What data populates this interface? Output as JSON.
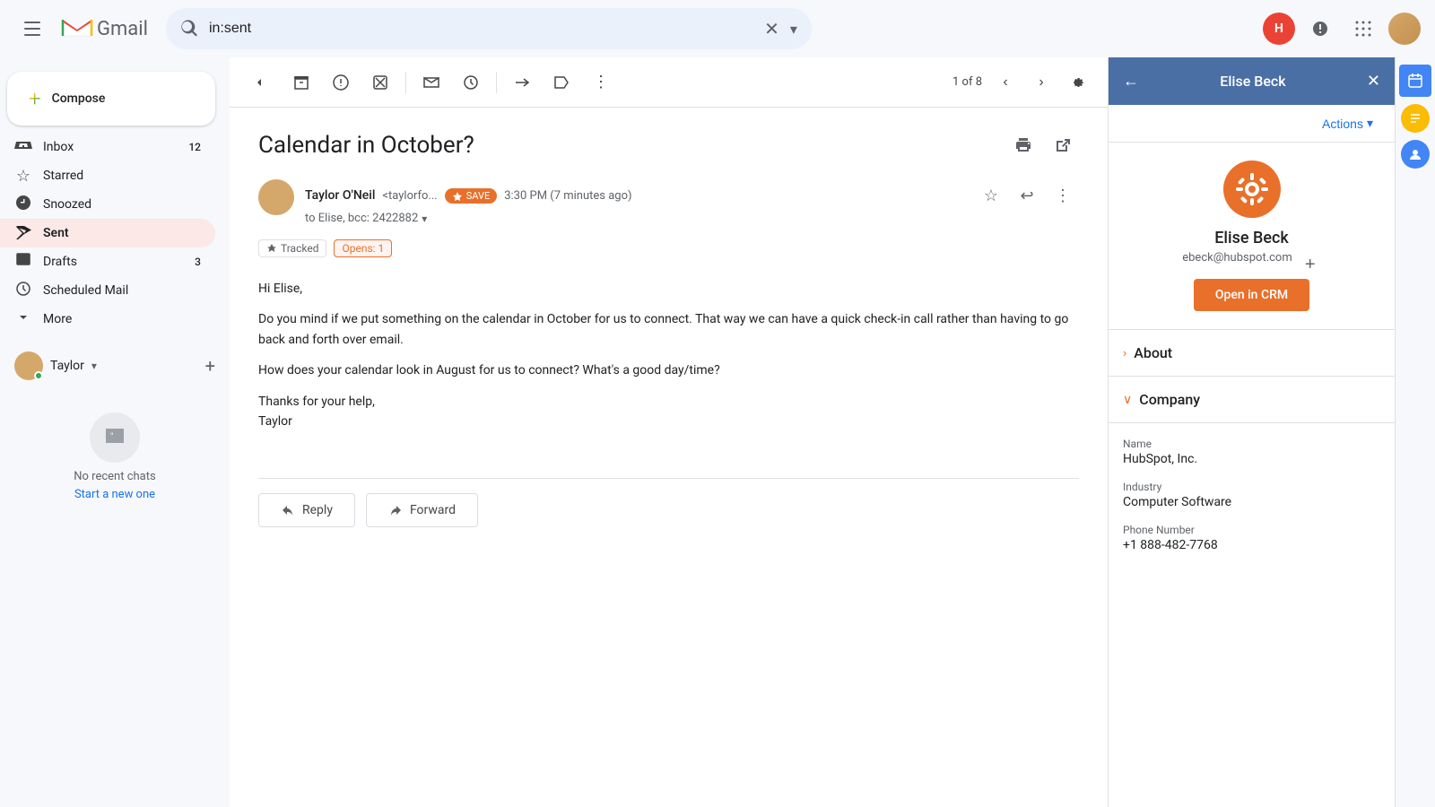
{
  "topbar": {
    "search_placeholder": "in:sent",
    "search_value": "in:sent",
    "gmail_label": "Gmail"
  },
  "sidebar": {
    "compose_label": "Compose",
    "nav_items": [
      {
        "id": "inbox",
        "label": "Inbox",
        "icon": "☰",
        "badge": "12",
        "active": false
      },
      {
        "id": "starred",
        "label": "Starred",
        "icon": "★",
        "badge": "",
        "active": false
      },
      {
        "id": "snoozed",
        "label": "Snoozed",
        "icon": "🕐",
        "badge": "",
        "active": false
      },
      {
        "id": "sent",
        "label": "Sent",
        "icon": "➤",
        "badge": "",
        "active": true
      },
      {
        "id": "drafts",
        "label": "Drafts",
        "icon": "📄",
        "badge": "3",
        "active": false
      },
      {
        "id": "scheduled",
        "label": "Scheduled Mail",
        "icon": "🕐",
        "badge": "",
        "active": false
      },
      {
        "id": "more",
        "label": "More",
        "icon": "∨",
        "badge": "",
        "active": false
      }
    ],
    "user_name": "Taylor",
    "no_chats_text": "No recent chats",
    "start_new_link": "Start a new one"
  },
  "toolbar": {
    "back_label": "←",
    "pagination_text": "1 of 8"
  },
  "email": {
    "subject": "Calendar in October?",
    "sender_name": "Taylor O'Neil",
    "sender_email": "<taylorfo...",
    "save_label": "SAVE",
    "time": "3:30 PM (7 minutes ago)",
    "to": "to Elise, bcc: 2422882",
    "tracked_label": "Tracked",
    "opens_label": "Opens: 1",
    "body_lines": [
      "Hi Elise,",
      "",
      "Do you mind if we put something on the calendar in October for us to connect. That way we can have a quick check-in call rather than having to go back and forth over email.",
      "",
      "How does your calendar look in August for us to connect? What's a good day/time?",
      "",
      "Thanks for your help,",
      "Taylor"
    ],
    "reply_label": "Reply",
    "forward_label": "Forward"
  },
  "right_panel": {
    "contact_name": "Elise Beck",
    "contact_email": "ebeck@hubspot.com",
    "actions_label": "Actions",
    "open_crm_label": "Open in CRM",
    "about_label": "About",
    "company_label": "Company",
    "company_name_label": "Name",
    "company_name_value": "HubSpot, Inc.",
    "industry_label": "Industry",
    "industry_value": "Computer Software",
    "phone_label": "Phone Number",
    "phone_value": "+1 888-482-7768"
  }
}
